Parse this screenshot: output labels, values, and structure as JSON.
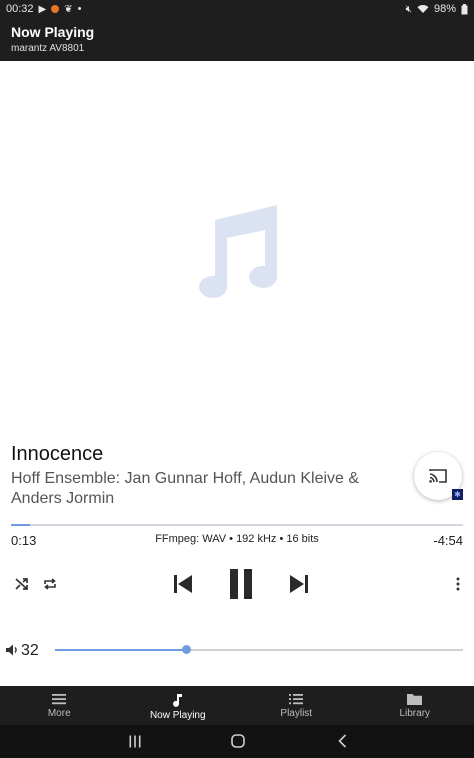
{
  "status": {
    "time": "00:32",
    "battery": "98%"
  },
  "header": {
    "title": "Now Playing",
    "subtitle": "marantz AV8801"
  },
  "track": {
    "title": "Innocence",
    "artist": "Hoff Ensemble: Jan Gunnar Hoff, Audun Kleive & Anders Jormin"
  },
  "playback": {
    "elapsed": "0:13",
    "remaining": "-4:54",
    "format": "FFmpeg: WAV • 192 kHz • 16 bits",
    "progress_fraction": 0.043,
    "state": "playing"
  },
  "volume": {
    "value": "32",
    "fraction": 0.32
  },
  "nav": {
    "items": [
      {
        "label": "More",
        "icon": "menu-icon"
      },
      {
        "label": "Now Playing",
        "icon": "music-note-icon",
        "active": true
      },
      {
        "label": "Playlist",
        "icon": "playlist-icon"
      },
      {
        "label": "Library",
        "icon": "folder-icon"
      }
    ]
  },
  "colors": {
    "accent": "#6f9be0",
    "bar": "#1e1e1e",
    "art_note": "#dbe3f3"
  }
}
